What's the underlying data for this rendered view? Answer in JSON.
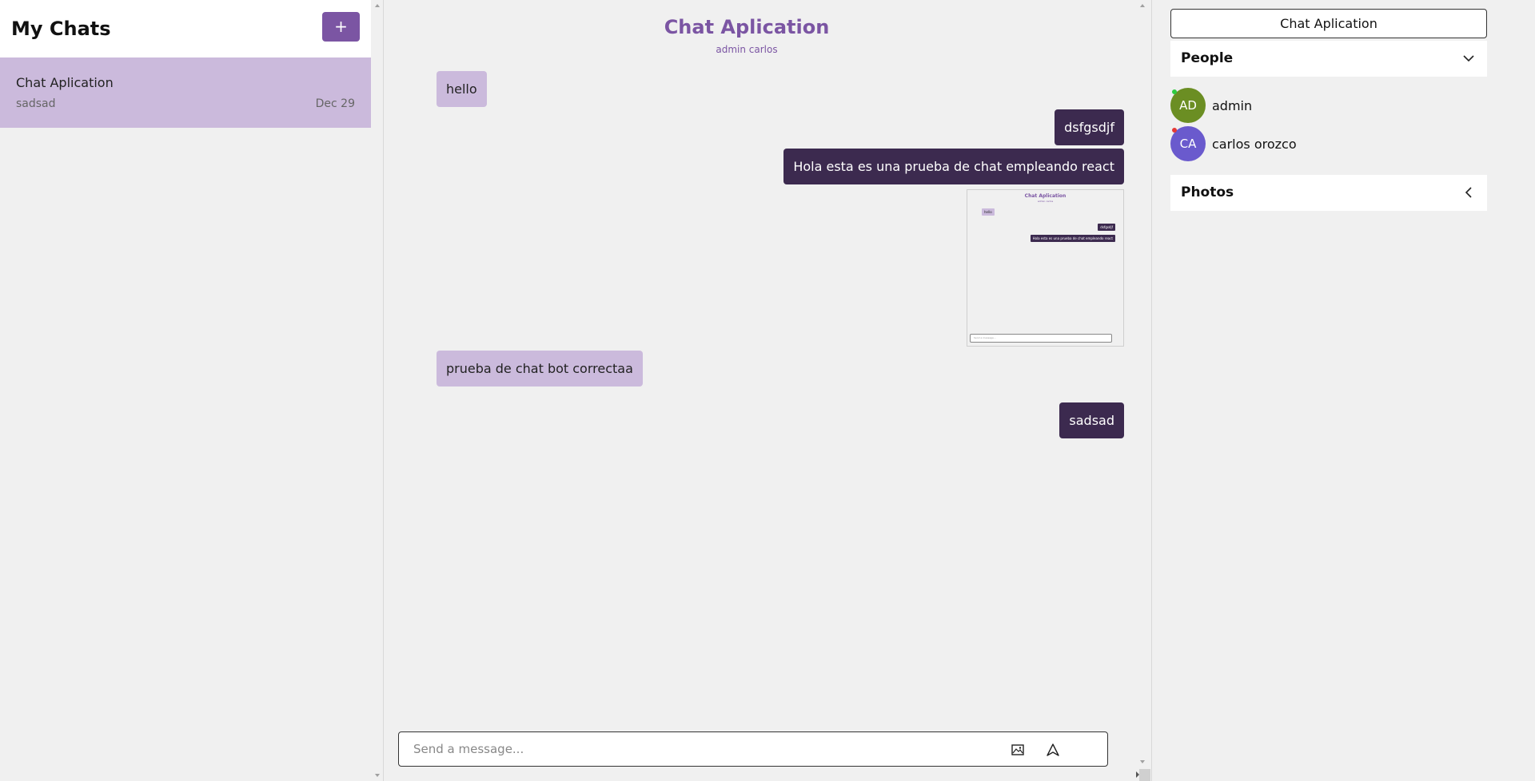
{
  "sidebar": {
    "title": "My Chats",
    "new_chat_label": "+",
    "chats": [
      {
        "title": "Chat Aplication",
        "last_message": "sadsad",
        "date": "Dec 29"
      }
    ]
  },
  "chat": {
    "title": "Chat Aplication",
    "subtitle": "admin carlos",
    "messages": [
      {
        "text": "hello",
        "direction": "incoming"
      },
      {
        "text": "dsfgsdjf",
        "direction": "outgoing"
      },
      {
        "text": "Hola esta es una prueba de chat empleando react",
        "direction": "outgoing"
      },
      {
        "type": "image",
        "direction": "outgoing"
      },
      {
        "text": "prueba de chat bot correctaa",
        "direction": "incoming"
      },
      {
        "text": "sadsad",
        "direction": "outgoing"
      }
    ],
    "thumbnail": {
      "title": "Chat Aplication",
      "subtitle": "admin carlos",
      "msg1": "hello",
      "msg2": "dsfgsdjf",
      "msg3": "Hola esta es una prueba de chat empleando react",
      "placeholder": "Send a message..."
    },
    "composer": {
      "placeholder": "Send a message...",
      "image_icon": "image-icon",
      "send_icon": "send-icon"
    }
  },
  "details": {
    "chat_name": "Chat Aplication",
    "people_title": "People",
    "people": [
      {
        "initials": "AD",
        "name": "admin",
        "avatar_color": "#6b8e23",
        "status_color": "#2ecc40"
      },
      {
        "initials": "CA",
        "name": "carlos orozco",
        "avatar_color": "#6a5acd",
        "status_color": "#e53935"
      }
    ],
    "photos_title": "Photos"
  },
  "colors": {
    "accent": "#7b55a3",
    "incoming_bubble": "#cbbadc",
    "outgoing_bubble": "#3c2a4f",
    "background": "#f0f0f0"
  }
}
